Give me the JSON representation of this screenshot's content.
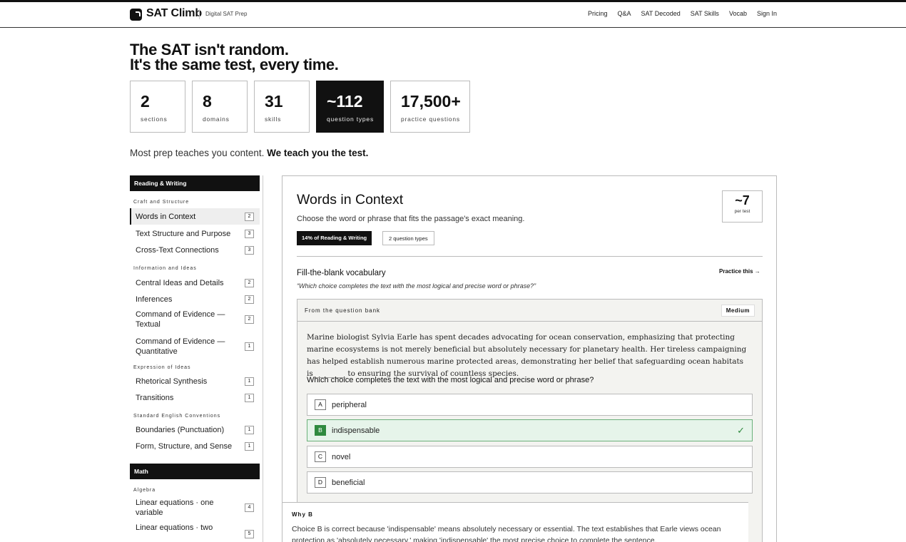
{
  "nav": {
    "brand": "SAT Climb",
    "tagline": "Digital SAT Prep",
    "links": [
      "Pricing",
      "Q&A",
      "SAT Decoded",
      "SAT Skills",
      "Vocab",
      "Sign In"
    ]
  },
  "hero": {
    "line1": "The SAT isn't random.",
    "line2": "It's the same test, every time."
  },
  "stats": [
    {
      "num": "2",
      "label": "sections"
    },
    {
      "num": "8",
      "label": "domains"
    },
    {
      "num": "31",
      "label": "skills"
    },
    {
      "num": "~112",
      "label": "question types"
    },
    {
      "num": "17,500+",
      "label": "practice questions"
    }
  ],
  "lede": {
    "plain": "Most prep teaches you content. ",
    "bold": "We teach you the test."
  },
  "sidebar": {
    "rw_header": "Reading & Writing",
    "groups": [
      {
        "title": "Craft and Structure",
        "items": [
          {
            "label": "Words in Context",
            "count": "2"
          },
          {
            "label": "Text Structure and Purpose",
            "count": "3"
          },
          {
            "label": "Cross-Text Connections",
            "count": "3"
          }
        ]
      },
      {
        "title": "Information and Ideas",
        "items": [
          {
            "label": "Central Ideas and Details",
            "count": "2"
          },
          {
            "label": "Inferences",
            "count": "2"
          },
          {
            "label": "Command of Evidence — Textual",
            "count": "2"
          },
          {
            "label": "Command of Evidence — Quantitative",
            "count": "1"
          }
        ]
      },
      {
        "title": "Expression of Ideas",
        "items": [
          {
            "label": "Rhetorical Synthesis",
            "count": "1"
          },
          {
            "label": "Transitions",
            "count": "1"
          }
        ]
      },
      {
        "title": "Standard English Conventions",
        "items": [
          {
            "label": "Boundaries (Punctuation)",
            "count": "1"
          },
          {
            "label": "Form, Structure, and Sense",
            "count": "1"
          }
        ]
      }
    ],
    "math_header": "Math",
    "math_groups": [
      {
        "title": "Algebra",
        "items": [
          {
            "label": "Linear equations · one variable",
            "count": "4"
          },
          {
            "label": "Linear equations · two",
            "count": "5"
          }
        ]
      }
    ]
  },
  "panel": {
    "title": "Words in Context",
    "description": "Choose the word or phrase that fits the passage's exact meaning.",
    "pill_share": "14% of Reading & Writing",
    "pill_types": "2 question types",
    "per_test_num": "~7",
    "per_test_label": "per test",
    "type_title": "Fill-the-blank vocabulary",
    "type_quote": "“Which choice completes the text with the most logical and precise word or phrase?”",
    "practice_link": "Practice this →",
    "question": {
      "source": "From the question bank",
      "difficulty": "Medium",
      "passage": "Marine biologist Sylvia Earle has spent decades advocating for ocean conservation, emphasizing that protecting marine ecosystems is not merely beneficial but absolutely necessary for planetary health. Her tireless campaigning has helped establish numerous marine protected areas, demonstrating her belief that safeguarding ocean habitats is ________ to ensuring the survival of countless species.",
      "prompt": "Which choice completes the text with the most logical and precise word or phrase?",
      "choices": [
        {
          "letter": "A",
          "text": "peripheral"
        },
        {
          "letter": "B",
          "text": "indispensable"
        },
        {
          "letter": "C",
          "text": "novel"
        },
        {
          "letter": "D",
          "text": "beneficial"
        }
      ],
      "check_mark": "✓",
      "why_title": "Why B",
      "why_text": "Choice B is correct because 'indispensable' means absolutely necessary or essential. The text establishes that Earle views ocean protection as 'absolutely necessary,' making 'indispensable' the most precise choice to complete the sentence."
    }
  }
}
